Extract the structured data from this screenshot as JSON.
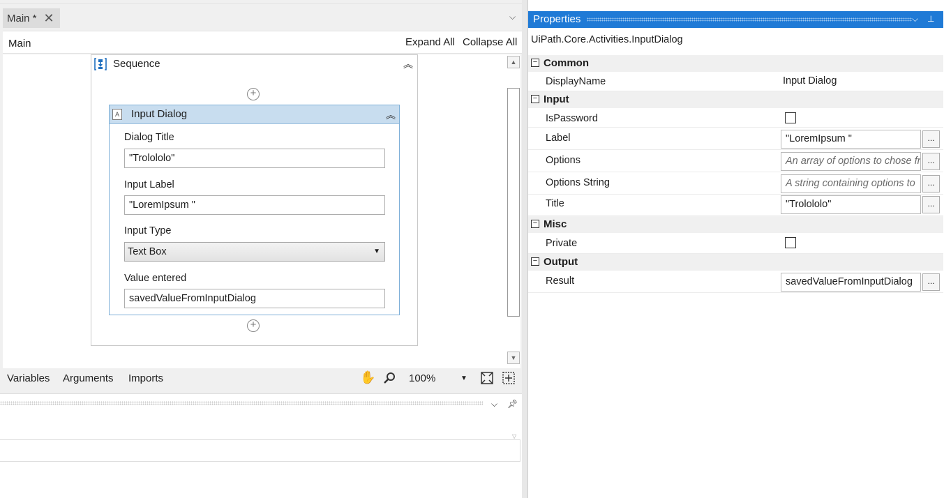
{
  "designer": {
    "tab_label": "Main *",
    "breadcrumb": "Main",
    "expand_all": "Expand All",
    "collapse_all": "Collapse All",
    "sequence_title": "Sequence",
    "activity": {
      "title": "Input Dialog",
      "dialog_title_label": "Dialog Title",
      "dialog_title_value": "\"Trolololo\"",
      "input_label_label": "Input Label",
      "input_label_value": "\"LoremIpsum \"",
      "input_type_label": "Input Type",
      "input_type_value": "Text Box",
      "value_entered_label": "Value entered",
      "value_entered_value": "savedValueFromInputDialog"
    }
  },
  "bottom_bar": {
    "variables": "Variables",
    "arguments": "Arguments",
    "imports": "Imports",
    "zoom": "100%"
  },
  "properties": {
    "header": "Properties",
    "type_name": "UiPath.Core.Activities.InputDialog",
    "categories": {
      "common": "Common",
      "input": "Input",
      "misc": "Misc",
      "output": "Output"
    },
    "rows": {
      "display_name": {
        "name": "DisplayName",
        "value": "Input Dialog"
      },
      "is_password": {
        "name": "IsPassword",
        "checked": false
      },
      "label": {
        "name": "Label",
        "value": "\"LoremIpsum \""
      },
      "options": {
        "name": "Options",
        "placeholder": "An array of options to chose from"
      },
      "options_string": {
        "name": "Options String",
        "placeholder": "A string containing options to"
      },
      "title": {
        "name": "Title",
        "value": "\"Trolololo\""
      },
      "private": {
        "name": "Private",
        "checked": false
      },
      "result": {
        "name": "Result",
        "value": "savedValueFromInputDialog"
      }
    },
    "ellipsis": "..."
  },
  "icons": {
    "close": "close-icon",
    "dropdown": "chevron-down-icon",
    "pin": "pin-icon",
    "collapse": "double-chevron-up-icon",
    "add": "plus-circle-icon",
    "hand": "hand-pan-icon",
    "zoom": "magnifier-icon",
    "fit": "fit-to-screen-icon",
    "reset": "reset-zoom-icon"
  }
}
